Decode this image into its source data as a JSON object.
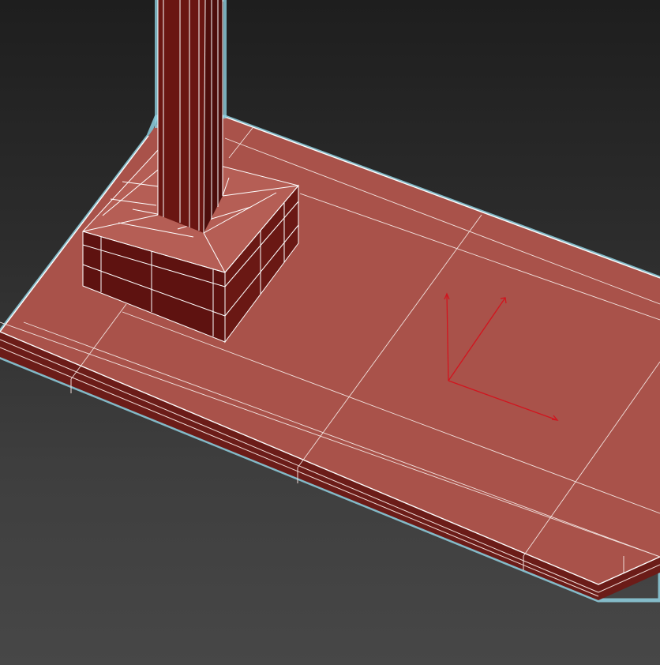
{
  "viewport": {
    "render_mode": "shaded-with-wireframe-edges",
    "selection": "selected-object-highlight"
  },
  "colors": {
    "background_top": "#1e1e1e",
    "background_bottom": "#474747",
    "object_face_lit": "#a9524a",
    "object_face_dark": "#5e1210",
    "wireframe": "#ffffff",
    "selection_outline": "#9fd9e8",
    "gizmo_axis": "#d2141e"
  },
  "objects": [
    {
      "id": "base-slab",
      "icon": "box-mesh",
      "selected": true
    },
    {
      "id": "column-shaft",
      "icon": "box-mesh",
      "selected": true
    },
    {
      "id": "column-footing",
      "icon": "box-mesh",
      "selected": true
    }
  ],
  "gizmo": {
    "type": "transform-axis-tripod",
    "axes": [
      "x",
      "y",
      "z"
    ]
  }
}
